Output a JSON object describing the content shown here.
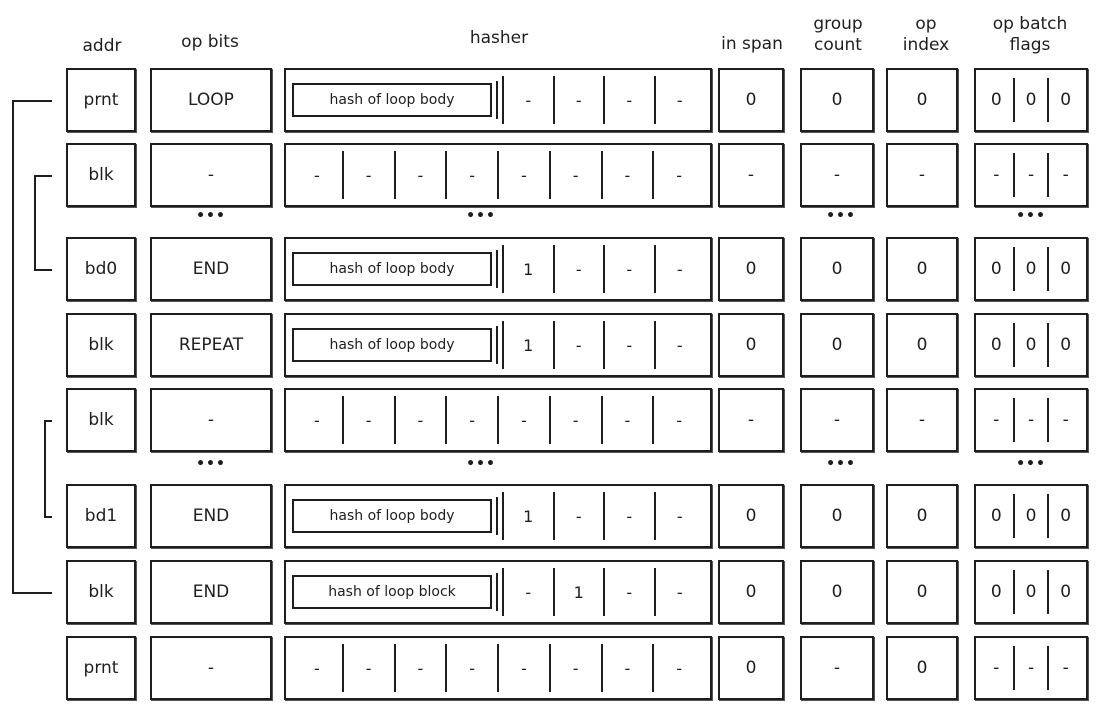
{
  "headers": {
    "addr": "addr",
    "op_bits": "op bits",
    "hasher": "hasher",
    "in_span": "in span",
    "group_count": "group\ncount",
    "op_index": "op\nindex",
    "op_batch_flags": "op batch\nflags"
  },
  "ellipsis": "•••",
  "rows": [
    {
      "addr": "prnt",
      "op_bits": "LOOP",
      "hash_label": "hash of loop body",
      "hasher_cells": [
        "-",
        "-",
        "-",
        "-"
      ],
      "in_span": "0",
      "group_count": "0",
      "op_index": "0",
      "flags": [
        "0",
        "0",
        "0"
      ]
    },
    {
      "addr": "blk",
      "op_bits": "-",
      "hash_label": null,
      "hasher_cells": [
        "-",
        "-",
        "-",
        "-",
        "-",
        "-",
        "-",
        "-"
      ],
      "in_span": "-",
      "group_count": "-",
      "op_index": "-",
      "flags": [
        "-",
        "-",
        "-"
      ]
    },
    {
      "addr": "bd0",
      "op_bits": "END",
      "hash_label": "hash of loop body",
      "hasher_cells": [
        "1",
        "-",
        "-",
        "-"
      ],
      "in_span": "0",
      "group_count": "0",
      "op_index": "0",
      "flags": [
        "0",
        "0",
        "0"
      ]
    },
    {
      "addr": "blk",
      "op_bits": "REPEAT",
      "hash_label": "hash of loop body",
      "hasher_cells": [
        "1",
        "-",
        "-",
        "-"
      ],
      "in_span": "0",
      "group_count": "0",
      "op_index": "0",
      "flags": [
        "0",
        "0",
        "0"
      ]
    },
    {
      "addr": "blk",
      "op_bits": "-",
      "hash_label": null,
      "hasher_cells": [
        "-",
        "-",
        "-",
        "-",
        "-",
        "-",
        "-",
        "-"
      ],
      "in_span": "-",
      "group_count": "-",
      "op_index": "-",
      "flags": [
        "-",
        "-",
        "-"
      ]
    },
    {
      "addr": "bd1",
      "op_bits": "END",
      "hash_label": "hash of loop body",
      "hasher_cells": [
        "1",
        "-",
        "-",
        "-"
      ],
      "in_span": "0",
      "group_count": "0",
      "op_index": "0",
      "flags": [
        "0",
        "0",
        "0"
      ]
    },
    {
      "addr": "blk",
      "op_bits": "END",
      "hash_label": "hash of loop block",
      "hasher_cells": [
        "-",
        "1",
        "-",
        "-"
      ],
      "in_span": "0",
      "group_count": "0",
      "op_index": "0",
      "flags": [
        "0",
        "0",
        "0"
      ]
    },
    {
      "addr": "prnt",
      "op_bits": "-",
      "hash_label": null,
      "hasher_cells": [
        "-",
        "-",
        "-",
        "-",
        "-",
        "-",
        "-",
        "-"
      ],
      "in_span": "0",
      "group_count": "-",
      "op_index": "0",
      "flags": [
        "-",
        "-",
        "-"
      ]
    }
  ],
  "ellipsis_after_rows": [
    1,
    4
  ],
  "ellipsis_columns": [
    "op_bits",
    "hasher",
    "group_count",
    "op_batch_flags"
  ],
  "brackets": [
    {
      "name": "outer-loop-bracket",
      "from_row": 0,
      "to_row": 6
    },
    {
      "name": "body0-bracket",
      "from_row": 1,
      "to_row": 2
    },
    {
      "name": "body1-bracket",
      "from_row": 4,
      "to_row": 5
    }
  ]
}
